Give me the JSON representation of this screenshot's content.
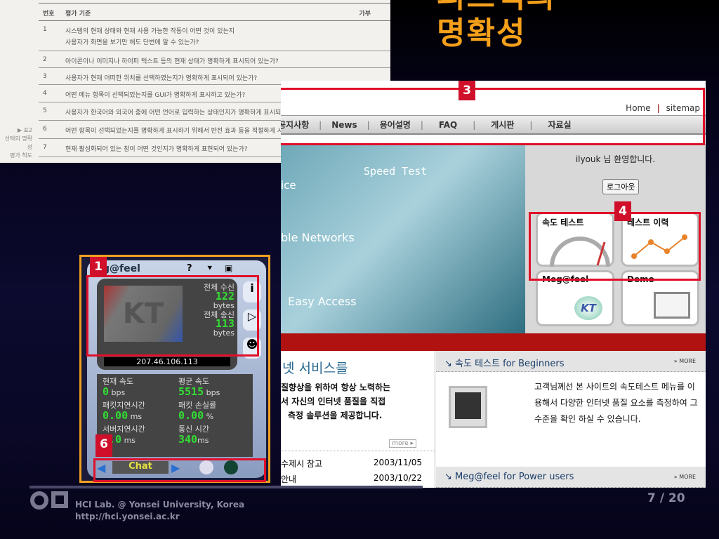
{
  "slide": {
    "title_line1": "피드백의",
    "title_line2": "명확성",
    "page": "7 / 20",
    "footer_org": "HCI Lab. @ Yonsei University, Korea",
    "footer_url": "http://hci.yonsei.ac.kr"
  },
  "table": {
    "col_no": "번호",
    "col_criteria": "평가 기준",
    "col_result": "가부",
    "side_label": [
      "▶ 표2",
      "선택의 명확성",
      "평가 척도"
    ],
    "rows": [
      {
        "no": "1",
        "text": "시스템의 현재 상태와 현재 사용 가능한 작동이 어떤 것이 있는지",
        "text2": "사용자가 화면을 보기만 해도 단번에 알 수 있는가?"
      },
      {
        "no": "2",
        "text": "아이콘이나 이미지나 하이퍼 텍스트 등의 현재 상태가 명확하게 표시되어 있는가?"
      },
      {
        "no": "3",
        "text": "사용자가 현재 어떠한 위치를 선택하였는지가 명확하게 표시되어 있는가?"
      },
      {
        "no": "4",
        "text": "어떤 메뉴 항목이 선택되었는지를 GUI가 명확하게 표시하고 있는가?"
      },
      {
        "no": "5",
        "text": "사용자가 한국어와 외국어 중에 어떤 언어로 입력하는 상태인지가 명확하게 표시되어 있는가?"
      },
      {
        "no": "6",
        "text": "어떤 항목이 선택되었는지를 명확하게 표시하기 위해서 반전 효과 등을 적절하게 사용하고 있는가?"
      },
      {
        "no": "7",
        "text": "현재 활성화되어 있는 창이 어떤 것인지가 명확하게 표현되어 있는가?"
      }
    ]
  },
  "web": {
    "home": "Home",
    "sitemap": "sitemap",
    "nav": [
      "공지사항",
      "News",
      "용어설명",
      "FAQ",
      "게시판",
      "자료실"
    ],
    "banner": {
      "speed": "Speed Test",
      "ice": "ice",
      "networks": "ble Networks",
      "easy": "Easy Access"
    },
    "welcome": "ilyouk 님  환영합니다.",
    "logout": "로그아웃",
    "tiles": [
      "속도 테스트",
      "테스트 이력",
      "Meg@feel",
      "Demo"
    ],
    "kt": "KT",
    "headline": "넷 서비스를",
    "intro": [
      "질향상을 위하여 항상 노력하는",
      "서 자신의 인터넷 품질을 직접",
      "측정 솔루션을 제공합니다."
    ],
    "more": "more ▸",
    "notices": [
      {
        "title": "수제시 참고",
        "date": "2003/11/05"
      },
      {
        "title": "안내",
        "date": "2003/10/22"
      }
    ],
    "beginners": "속도 테스트 for Beginners",
    "beginners_text": "고객님께선 본 사이트의 속도테스트 메뉴를 이용해서 다양한 인터넷 품질 요소를 측정하여 그 수준을 확인 하실 수 있습니다.",
    "power": "Meg@feel for Power users",
    "more2": "» MORE"
  },
  "widget": {
    "title": "g@feel",
    "help": "?",
    "recv_label": "전체 수신",
    "recv": "122",
    "bytes": "bytes",
    "sent_label": "전체 송신",
    "sent": "113",
    "ip": "207.46.106.113",
    "cur_label": "현재 속도",
    "cur": "0",
    "bps": "bps",
    "avg_label": "평균 속도",
    "avg": "5515",
    "delay_label": "패킷지연시간",
    "delay": "0.00",
    "ms": "ms",
    "loss_label": "패킷 손실률",
    "loss": "0.00",
    "pct": "%",
    "srv_label": "서버지연시간",
    "srv": "0.0",
    "time_label": "통신 시간",
    "time": "340",
    "chat": "Chat"
  },
  "badges": [
    "1",
    "3",
    "4",
    "6"
  ],
  "colors": {
    "accent": "#f5a01a",
    "highlight": "#e0102a"
  }
}
